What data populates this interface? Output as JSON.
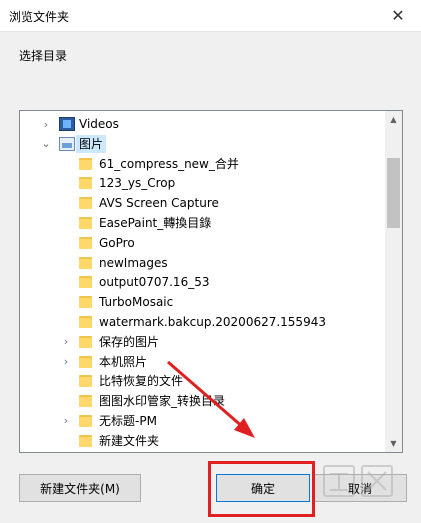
{
  "window": {
    "title": "浏览文件夹",
    "close_glyph": "✕"
  },
  "prompt": "选择目录",
  "tree": {
    "items": [
      {
        "label": "Videos",
        "icon": "video-library-icon",
        "chevron": "›",
        "indent": 0,
        "selected": false
      },
      {
        "label": "图片",
        "icon": "pictures-library-icon",
        "chevron": "⌄",
        "indent": 0,
        "selected": true
      },
      {
        "label": "61_compress_new_合并",
        "icon": "folder-icon",
        "chevron": "",
        "indent": 1,
        "selected": false
      },
      {
        "label": "123_ys_Crop",
        "icon": "folder-icon",
        "chevron": "",
        "indent": 1,
        "selected": false
      },
      {
        "label": "AVS Screen Capture",
        "icon": "folder-icon",
        "chevron": "",
        "indent": 1,
        "selected": false
      },
      {
        "label": "EasePaint_轉換目錄",
        "icon": "folder-icon",
        "chevron": "",
        "indent": 1,
        "selected": false
      },
      {
        "label": "GoPro",
        "icon": "folder-icon",
        "chevron": "",
        "indent": 1,
        "selected": false
      },
      {
        "label": "newImages",
        "icon": "folder-icon",
        "chevron": "",
        "indent": 1,
        "selected": false
      },
      {
        "label": "output0707.16_53",
        "icon": "folder-icon",
        "chevron": "",
        "indent": 1,
        "selected": false
      },
      {
        "label": "TurboMosaic",
        "icon": "folder-icon",
        "chevron": "",
        "indent": 1,
        "selected": false
      },
      {
        "label": "watermark.bakcup.20200627.155943",
        "icon": "folder-icon",
        "chevron": "",
        "indent": 1,
        "selected": false
      },
      {
        "label": "保存的图片",
        "icon": "folder-icon",
        "chevron": "›",
        "indent": 1,
        "selected": false
      },
      {
        "label": "本机照片",
        "icon": "folder-icon",
        "chevron": "›",
        "indent": 1,
        "selected": false
      },
      {
        "label": "比特恢复的文件",
        "icon": "folder-icon",
        "chevron": "",
        "indent": 1,
        "selected": false
      },
      {
        "label": "图图水印管家_转换目录",
        "icon": "folder-icon",
        "chevron": "",
        "indent": 1,
        "selected": false
      },
      {
        "label": "无标题-PM",
        "icon": "folder-icon",
        "chevron": "›",
        "indent": 1,
        "selected": false
      },
      {
        "label": "新建文件夹",
        "icon": "folder-icon",
        "chevron": "",
        "indent": 1,
        "selected": false
      }
    ]
  },
  "buttons": {
    "new_folder": "新建文件夹(M)",
    "ok": "确定",
    "cancel": "取消"
  },
  "colors": {
    "selection": "#cce8ff",
    "annotation_red": "#e02020",
    "default_button_border": "#0078d7"
  }
}
